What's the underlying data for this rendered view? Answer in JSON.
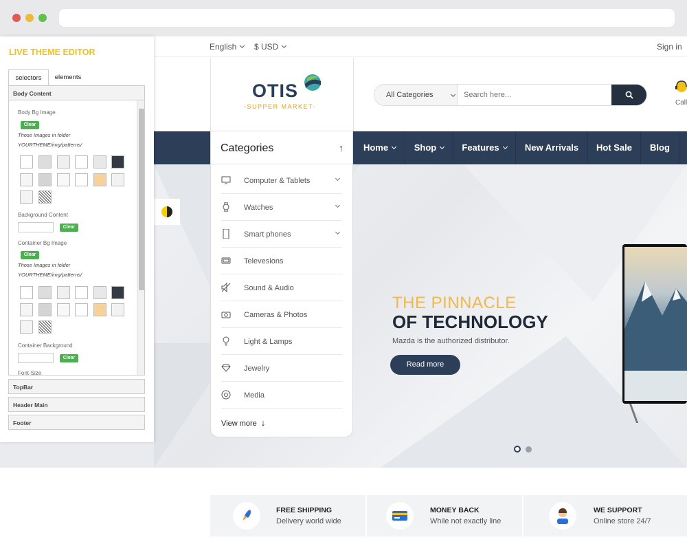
{
  "browser": {
    "colors": {
      "close": "#e05a56",
      "min": "#efb93a",
      "max": "#5fc04b"
    }
  },
  "topbar": {
    "language": "English",
    "currency": "$ USD",
    "signin": "Sign in"
  },
  "header": {
    "logo_text": "OTIS",
    "logo_sub": "-SUPPER MARKET-",
    "search": {
      "category": "All Categories",
      "placeholder": "Search here..."
    },
    "call_label": "Call"
  },
  "nav": {
    "categories_title": "Categories",
    "items": [
      {
        "label": "Home"
      },
      {
        "label": "Shop"
      },
      {
        "label": "Features"
      },
      {
        "label": "New Arrivals"
      },
      {
        "label": "Hot Sale"
      },
      {
        "label": "Blog"
      }
    ]
  },
  "categories": {
    "items": [
      {
        "label": "Computer & Tablets",
        "icon": "monitor-icon"
      },
      {
        "label": "Watches",
        "icon": "watch-icon"
      },
      {
        "label": "Smart phones",
        "icon": "phone-icon"
      },
      {
        "label": "Televesions",
        "icon": "tv-icon"
      },
      {
        "label": "Sound & Audio",
        "icon": "speaker-icon"
      },
      {
        "label": "Cameras & Photos",
        "icon": "camera-icon"
      },
      {
        "label": "Light & Lamps",
        "icon": "bulb-icon"
      },
      {
        "label": "Jewelry",
        "icon": "diamond-icon"
      },
      {
        "label": "Media",
        "icon": "media-icon"
      }
    ],
    "view_more": "View more"
  },
  "hero": {
    "line1": "THE PINNACLE",
    "line2": "OF TECHNOLOGY",
    "desc": "Mazda is the authorized distributor.",
    "button": "Read more"
  },
  "features": [
    {
      "title": "FREE SHIPPING",
      "desc": "Delivery world wide",
      "icon": "rocket-icon"
    },
    {
      "title": "MONEY BACK",
      "desc": "While not exactly line",
      "icon": "credit-card-icon"
    },
    {
      "title": "WE SUPPORT",
      "desc": "Online store 24/7",
      "icon": "support-agent-icon"
    }
  ],
  "editor": {
    "title": "LIVE THEME EDITOR",
    "tabs": [
      "selectors",
      "elements"
    ],
    "body_content": "Body Content",
    "body_bg_image": "Body Bg Image",
    "clear": "Clear",
    "note1": "Those Images in folder",
    "note2": "YOURTHEME/img/patterns/",
    "background_content": "Background Content",
    "container_bg_image": "Container Bg Image",
    "container_background": "Container Background",
    "font_size": "Font-Size",
    "sections": [
      "TopBar",
      "Header Main",
      "Footer"
    ]
  },
  "colors": {
    "navy": "#2d3e58",
    "accent": "#f2b84b",
    "editor_title": "#f2c01a",
    "clear_green": "#4caf50"
  }
}
